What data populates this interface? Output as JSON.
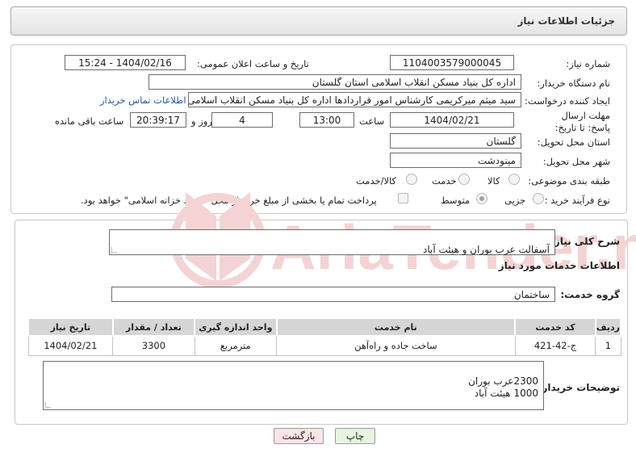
{
  "header": {
    "title": "جزئیات اطلاعات نیاز"
  },
  "form": {
    "need_number_label": "شماره نیاز:",
    "need_number": "1104003579000045",
    "announce_label": "تاریخ و ساعت اعلان عمومی:",
    "announce_value": "1404/02/16 - 15:24",
    "buyer_org_label": "نام دستگاه خریدار:",
    "buyer_org": "اداره کل بنیاد مسکن انقلاب اسلامی استان گلستان",
    "creator_label": "ایجاد کننده درخواست:",
    "creator": "سید میثم میرکریمی کارشناس امور قراردادها اداره کل بنیاد مسکن انقلاب اسلامی استان گلستان",
    "contact_link": "اطلاعات تماس خریدار",
    "deadline_label": "مهلت ارسال پاسخ: تا تاریخ:",
    "deadline_date": "1404/02/21",
    "time_label": "ساعت",
    "deadline_time": "13:00",
    "days_value": "4",
    "days_label": "روز و",
    "remaining_time": "20:39:17",
    "remaining_label": "ساعت باقی مانده",
    "province_label": "استان محل تحویل:",
    "province": "گلستان",
    "city_label": "شهر محل تحویل:",
    "city": "مینودشت",
    "category_label": "طبقه بندی موضوعی:",
    "category_options": [
      "کالا",
      "خدمت",
      "کالا/خدمت"
    ],
    "process_label": "نوع فرآیند خرید :",
    "process_options": [
      "جزیی",
      "متوسط"
    ],
    "payment_note": "پرداخت تمام یا بخشی از مبلغ خرید،از محل \"اسناد خزانه اسلامی\" خواهد بود."
  },
  "details": {
    "summary_label": "شرح کلی نیاز:",
    "summary": "آسفالت عرب بوران و هیئت آباد",
    "services_heading": "اطلاعات خدمات مورد نیاز",
    "service_group_label": "گروه خدمت:",
    "service_group": "ساختمان",
    "table": {
      "headers": [
        "ردیف",
        "کد خدمت",
        "نام خدمت",
        "واحد اندازه گیری",
        "تعداد / مقدار",
        "تاریخ نیاز"
      ],
      "rows": [
        [
          "1",
          "ج-42-421",
          "ساخت جاده و راه‌آهن",
          "مترمربع",
          "3300",
          "1404/02/21"
        ]
      ]
    },
    "buyer_notes_label": "توضیحات خریدار:",
    "buyer_notes": "2300عرب بوران\n1000 هیئت آباد"
  },
  "buttons": {
    "print": "چاپ",
    "back": "بازگشت"
  },
  "colors": {
    "back_button_bg": "#fde4e4",
    "print_button_bg": "#e6f5e0",
    "link": "#1e56b0",
    "watermark": "#f3d3d3"
  },
  "watermark": {
    "text": "AriaTender.neT"
  }
}
